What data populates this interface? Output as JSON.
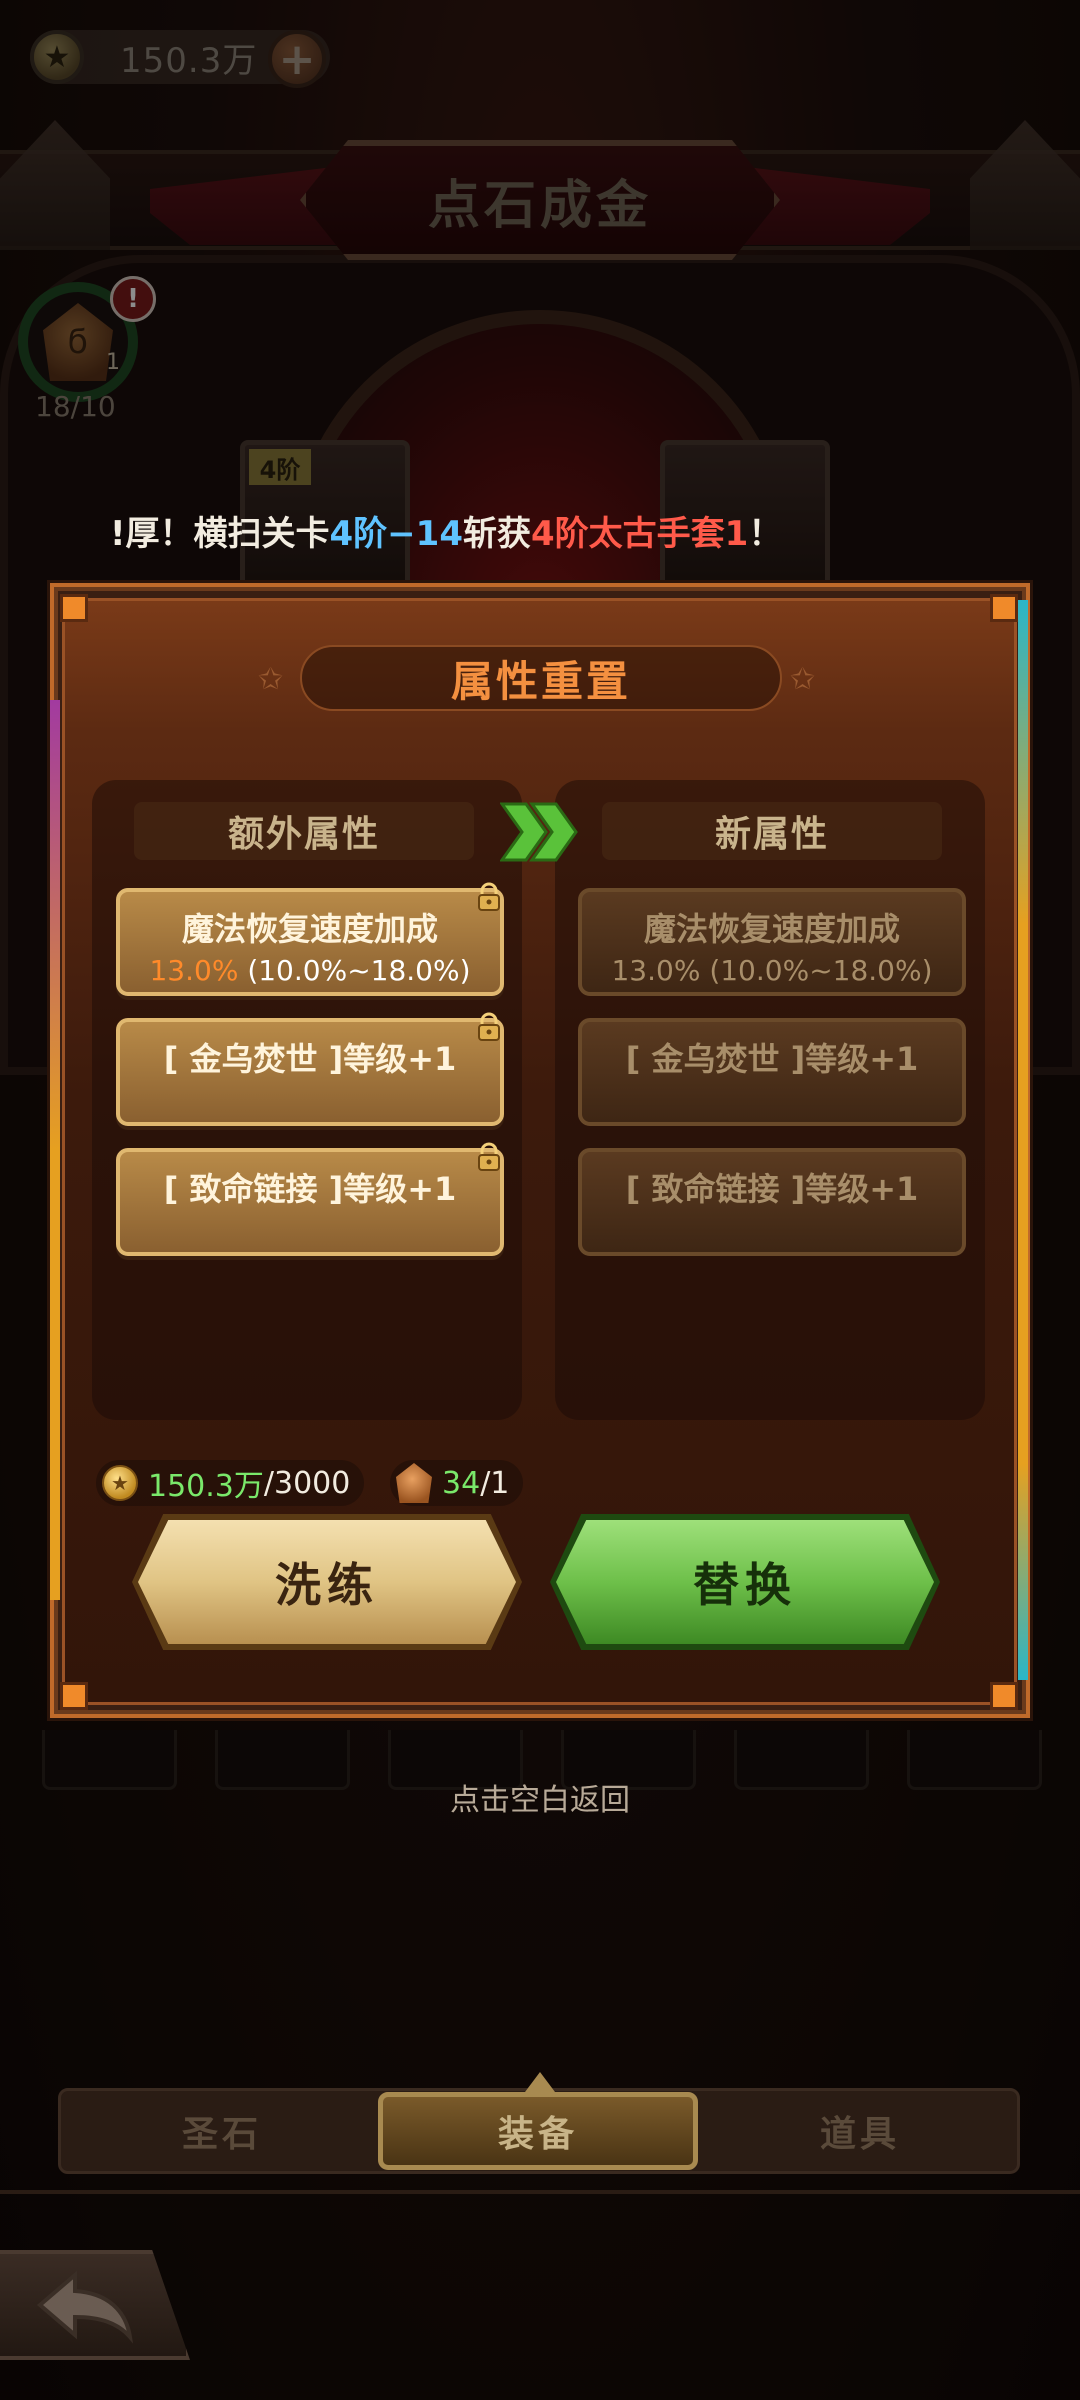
{
  "top_bar": {
    "currency_icon": "star-coin-icon",
    "gold_amount": "150.3万",
    "add_icon": "plus-icon"
  },
  "page_title": "点石成金",
  "level_badge": {
    "stone_count": "1",
    "alert": "!",
    "progress": "18/10"
  },
  "marquee": {
    "prefix": "!厚！横扫关卡 ",
    "stage": "4阶−14",
    "middle": " 斩获 ",
    "item": "4阶太古手套1",
    "suffix": " ！"
  },
  "modal": {
    "title": "属性重置",
    "left_header": "额外属性",
    "right_header": "新属性",
    "old_attrs": [
      {
        "name": "魔法恢复速度加成",
        "value_current": "13.0%",
        "value_range": " (10.0%~18.0%)",
        "locked": true
      },
      {
        "name": "[ 金乌焚世 ]等级+1",
        "locked": true
      },
      {
        "name": "[ 致命链接 ]等级+1",
        "locked": true
      }
    ],
    "new_attrs": [
      {
        "name": "魔法恢复速度加成",
        "value": "13.0% (10.0%~18.0%)"
      },
      {
        "name": "[ 金乌焚世 ]等级+1"
      },
      {
        "name": "[ 致命链接 ]等级+1"
      }
    ],
    "cost_gold": {
      "have": "150.3万",
      "need": "/3000"
    },
    "cost_stone": {
      "have": "34",
      "need": "/1"
    },
    "refine_label": "洗练",
    "replace_label": "替换"
  },
  "tap_hint": "点击空白返回",
  "tabs": [
    {
      "label": "圣石",
      "active": false
    },
    {
      "label": "装备",
      "active": true
    },
    {
      "label": "道具",
      "active": false
    }
  ],
  "background_slot_label": "4阶",
  "colors": {
    "accent_orange": "#f49040",
    "green_button": "#6ec04a",
    "gold_button": "#e0c484",
    "value_highlight": "#ff8a2a",
    "marquee_blue": "#5fc3ff",
    "marquee_red": "#ff5a4a"
  }
}
